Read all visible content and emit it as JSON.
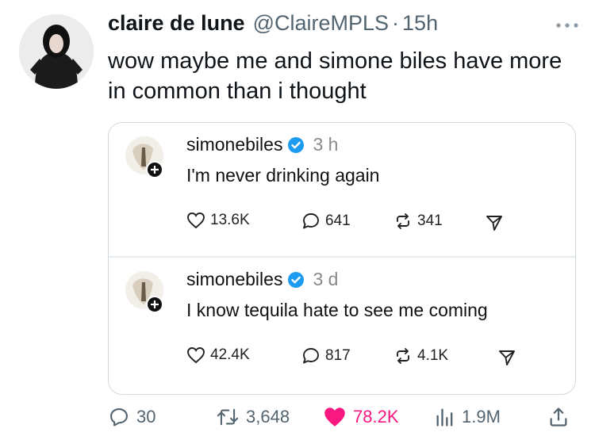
{
  "tweet": {
    "display_name": "claire de lune",
    "handle": "@ClaireMPLS",
    "separator": "·",
    "time": "15h",
    "text": "wow maybe me and simone biles have more in common than i thought"
  },
  "quoted_posts": [
    {
      "username": "simonebiles",
      "time": "3 h",
      "text": "I'm never drinking again",
      "likes": "13.6K",
      "replies": "641",
      "reposts": "341"
    },
    {
      "username": "simonebiles",
      "time": "3 d",
      "text": "I know tequila hate to see me coming",
      "likes": "42.4K",
      "replies": "817",
      "reposts": "4.1K"
    }
  ],
  "actions": {
    "replies": "30",
    "reposts": "3,648",
    "likes": "78.2K",
    "views": "1.9M"
  },
  "colors": {
    "like_active": "#f91880",
    "verified": "#1d9bf0",
    "muted": "#536471",
    "border": "#cfd9de"
  },
  "icons": [
    "more-icon",
    "verified-icon",
    "heart-icon",
    "comment-icon",
    "repost-icon",
    "send-icon",
    "reply-icon",
    "retweet-icon",
    "views-icon",
    "share-icon"
  ]
}
